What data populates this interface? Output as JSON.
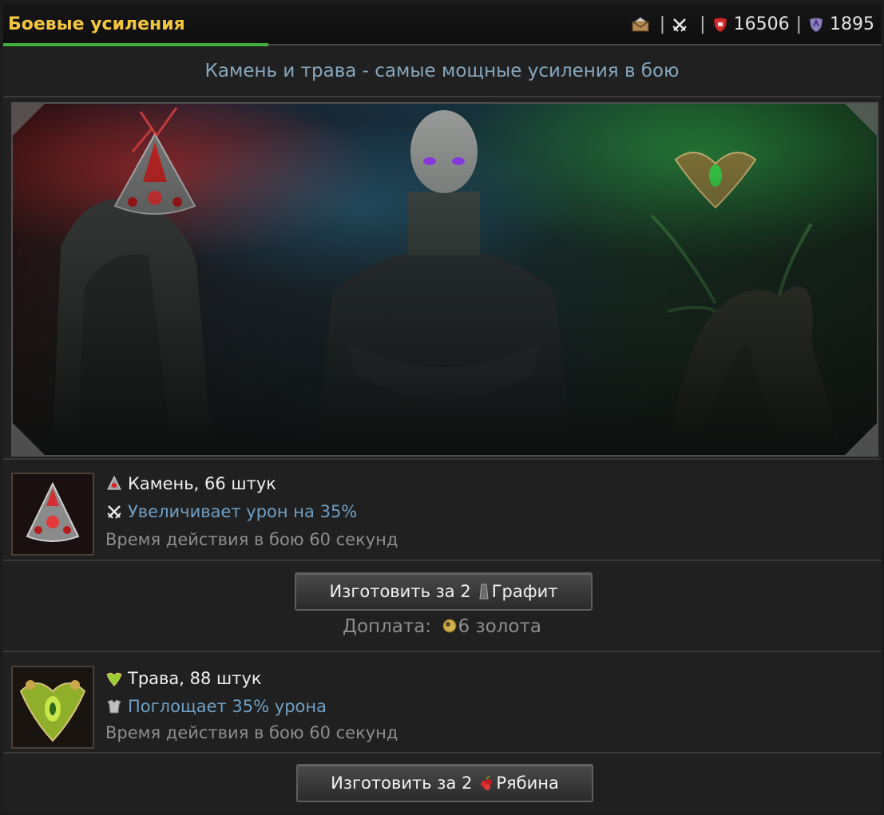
{
  "header": {
    "title": "Боевые усиления",
    "icons": [
      "mail-icon",
      "crossed-swords-icon",
      "red-shield-icon",
      "purple-shield-icon"
    ],
    "health_value": "16506",
    "defense_value": "1895",
    "separator": "|"
  },
  "subtitle": "Камень и трава - самые мощные усиления в бою",
  "items": [
    {
      "icon": "stone-emblem-icon",
      "name": "Камень, 66 штук",
      "effect_icon": "crossed-swords-icon",
      "effect": "Увеличивает урон на 35%",
      "duration": "Время действия в бою 60 секунд",
      "button_prefix": "Изготовить за 2",
      "button_resource": "Графит",
      "button_resource_icon": "graphite-icon",
      "surcharge_label": "Доплата:",
      "surcharge_value": "6 золота",
      "surcharge_icon": "gold-coin-icon"
    },
    {
      "icon": "herb-emblem-icon",
      "name": "Трава, 88 штук",
      "effect_icon": "armor-icon",
      "effect": "Поглощает 35% урона",
      "duration": "Время действия в бою 60 секунд",
      "button_prefix": "Изготовить за 2",
      "button_resource": "Рябина",
      "button_resource_icon": "rowan-berry-icon"
    }
  ],
  "colors": {
    "title": "#f2c63d",
    "accent": "#3fae3a",
    "subtitle": "#86a7be",
    "effect": "#6fa0c6"
  }
}
